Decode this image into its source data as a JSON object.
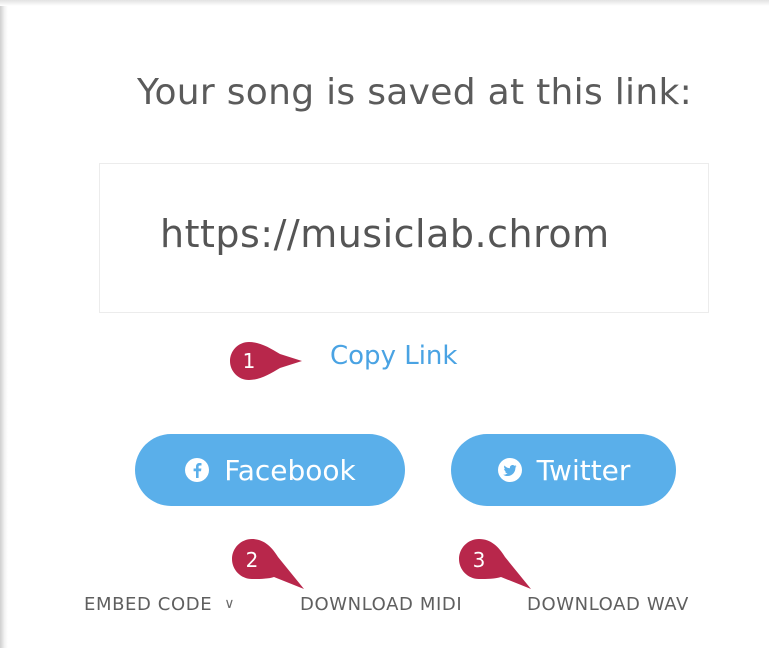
{
  "title": "Your song is saved at this link:",
  "link": {
    "url": "https://musiclab.chrom"
  },
  "copy_link_label": "Copy Link",
  "share": {
    "facebook_label": "Facebook",
    "twitter_label": "Twitter"
  },
  "actions": {
    "embed_label": "EMBED CODE",
    "download_midi_label": "DOWNLOAD MIDI",
    "download_wav_label": "DOWNLOAD WAV"
  },
  "markers": [
    {
      "label": "1"
    },
    {
      "label": "2"
    },
    {
      "label": "3"
    }
  ],
  "colors": {
    "accent": "#5aafea",
    "link": "#4aa3e3",
    "marker": "#b8274b"
  }
}
